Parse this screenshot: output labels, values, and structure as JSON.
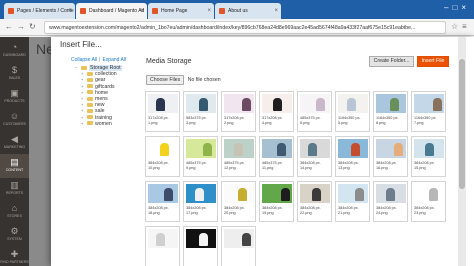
{
  "browser": {
    "tabs": [
      {
        "label": "Pages / Elements / Conte",
        "active": false
      },
      {
        "label": "Dashboard / Magento Ad",
        "active": true
      },
      {
        "label": "Home Page",
        "active": false
      },
      {
        "label": "About us",
        "active": false
      }
    ],
    "url": "www.magentoextension.com/magento2/admin_1bo7eu/admin/dashboard/index/key/896cb768ea24d8e969aac2e45ad5674f48a9a433f27aaf675e15c91eabtbe..."
  },
  "sidebar": {
    "items": [
      {
        "label": "Dashboard",
        "icon": "dashboard-icon",
        "glyph": "◔"
      },
      {
        "label": "Sales",
        "icon": "dollar-icon",
        "glyph": "$"
      },
      {
        "label": "Products",
        "icon": "box-icon",
        "glyph": "▣"
      },
      {
        "label": "Customers",
        "icon": "people-icon",
        "glyph": "☺"
      },
      {
        "label": "Marketing",
        "icon": "megaphone-icon",
        "glyph": "◀"
      },
      {
        "label": "Content",
        "icon": "layout-icon",
        "glyph": "▤"
      },
      {
        "label": "Reports",
        "icon": "bar-chart-icon",
        "glyph": "▥"
      },
      {
        "label": "Stores",
        "icon": "store-icon",
        "glyph": "⌂"
      },
      {
        "label": "System",
        "icon": "gear-icon",
        "glyph": "⚙"
      },
      {
        "label": "Find Partners",
        "icon": "puzzle-icon",
        "glyph": "✚"
      }
    ]
  },
  "behind": {
    "title": "New"
  },
  "modal": {
    "title": "Insert File...",
    "close_glyph": "✕",
    "collapse_all": "Collapse All",
    "separator": "|",
    "expand_all": "Expand All",
    "tree": [
      {
        "label": "Storage Root",
        "level": 0,
        "expander": "−"
      },
      {
        "label": "collection",
        "level": 1,
        "expander": "+"
      },
      {
        "label": "gear",
        "level": 1,
        "expander": "+"
      },
      {
        "label": "giftcards",
        "level": 1,
        "expander": "+"
      },
      {
        "label": "home",
        "level": 1,
        "expander": "+"
      },
      {
        "label": "mens",
        "level": 1,
        "expander": "+"
      },
      {
        "label": "new",
        "level": 1,
        "expander": "+"
      },
      {
        "label": "sale",
        "level": 1,
        "expander": "+"
      },
      {
        "label": "training",
        "level": 1,
        "expander": "+"
      },
      {
        "label": "women",
        "level": 1,
        "expander": "+"
      }
    ],
    "storage_title": "Media Storage",
    "create_folder": "Create Folder...",
    "insert_file": "Insert File",
    "choose_files": "Choose Files",
    "no_file": "No file chosen",
    "files": [
      {
        "c1": "317x208 px.",
        "c2": "1.png",
        "bg": "#eef0f4",
        "fg": "#2c3550"
      },
      {
        "c1": "583x375 px.",
        "c2": "3.png",
        "bg": "#dfe9ee",
        "fg": "#355a70"
      },
      {
        "c1": "317x208 px.",
        "c2": "2.png",
        "bg": "#f1e6ef",
        "fg": "#6d4a63"
      },
      {
        "c1": "317x208 px.",
        "c2": "4.png",
        "bg": "#f6eeea",
        "fg": "#1f1f1f"
      },
      {
        "c1": "485x375 px.",
        "c2": "6.png",
        "bg": "#f7f4f8",
        "fg": "#c9b8c9"
      },
      {
        "c1": "1164x350 px.",
        "c2": "5.png",
        "bg": "#f4f2ee",
        "fg": "#b7c5d6"
      },
      {
        "c1": "1164x350 px.",
        "c2": "8.png",
        "bg": "#a9c6de",
        "fg": "#6a8f5b"
      },
      {
        "c1": "1164x350 px.",
        "c2": "7.png",
        "bg": "#c3d7e9",
        "fg": "#88725e"
      },
      {
        "c1": "384x208 px.",
        "c2": "10.png",
        "bg": "#ffffff",
        "fg": "#f2d21c"
      },
      {
        "c1": "485x375 px.",
        "c2": "9.png",
        "bg": "#d6e89a",
        "fg": "#8fb44a"
      },
      {
        "c1": "485x375 px.",
        "c2": "12.png",
        "bg": "#bcd2c8",
        "fg": "#c7c2b4"
      },
      {
        "c1": "485x375 px.",
        "c2": "11.png",
        "bg": "#a6bfd1",
        "fg": "#3f5a71"
      },
      {
        "c1": "384x208 px.",
        "c2": "14.png",
        "bg": "#d9d9d9",
        "fg": "#5a7a8a"
      },
      {
        "c1": "384x208 px.",
        "c2": "13.png",
        "bg": "#8ab8d9",
        "fg": "#c44d2e"
      },
      {
        "c1": "384x208 px.",
        "c2": "16.png",
        "bg": "#c7d6e2",
        "fg": "#e5ad7a"
      },
      {
        "c1": "384x208 px.",
        "c2": "15.png",
        "bg": "#d4e4ec",
        "fg": "#4a7a92"
      },
      {
        "c1": "384x208 px.",
        "c2": "18.png",
        "bg": "#a9c8e4",
        "fg": "#3e4b6b"
      },
      {
        "c1": "384x208 px.",
        "c2": "17.png",
        "bg": "#2f8fc8",
        "fg": "#f0f0f0"
      },
      {
        "c1": "384x208 px.",
        "c2": "20.png",
        "bg": "#fbfbfb",
        "fg": "#c7ad2f"
      },
      {
        "c1": "384x208 px.",
        "c2": "19.png",
        "bg": "#62a84a",
        "fg": "#1d1d1d"
      },
      {
        "c1": "384x208 px.",
        "c2": "22.png",
        "bg": "#d8d2c7",
        "fg": "#3b3b3b"
      },
      {
        "c1": "384x208 px.",
        "c2": "21.png",
        "bg": "#d3e5f1",
        "fg": "#8c8c8c"
      },
      {
        "c1": "384x208 px.",
        "c2": "24.png",
        "bg": "#d9dee4",
        "fg": "#6e7d8c"
      },
      {
        "c1": "384x208 px.",
        "c2": "23.png",
        "bg": "#ffffff",
        "fg": "#b7b7b7"
      },
      {
        "c1": "",
        "c2": "",
        "bg": "#f5f5f5",
        "fg": "#cfcfcf"
      },
      {
        "c1": "",
        "c2": "",
        "bg": "#111111",
        "fg": "#f4f4f4"
      },
      {
        "c1": "",
        "c2": "",
        "bg": "#eeeeee",
        "fg": "#444444"
      }
    ]
  }
}
